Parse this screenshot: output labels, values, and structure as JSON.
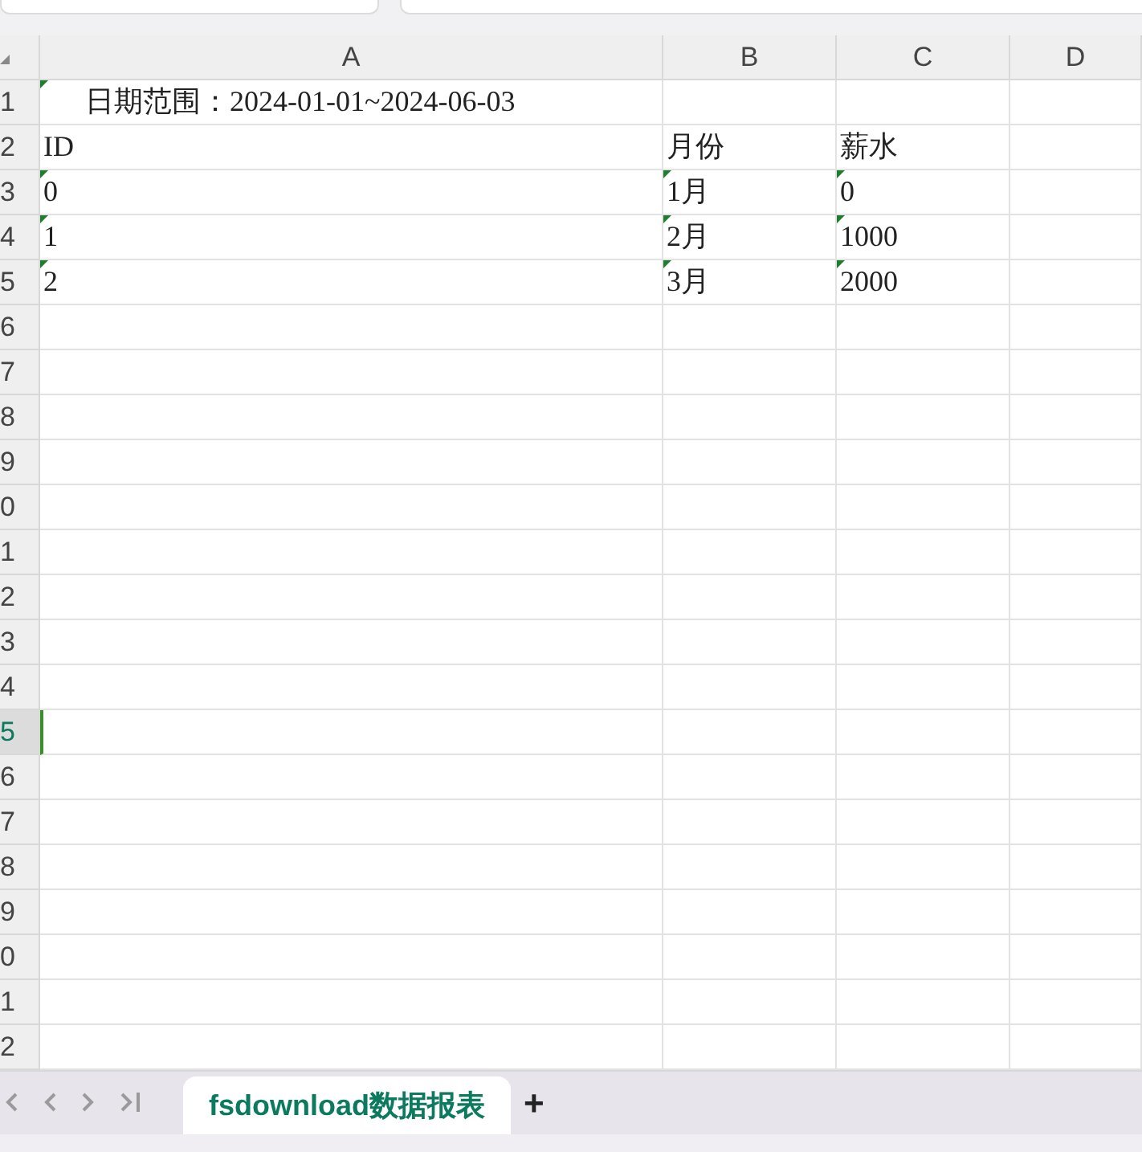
{
  "columns": [
    {
      "label": "A",
      "selected": false
    },
    {
      "label": "B",
      "selected": false
    },
    {
      "label": "C",
      "selected": false
    },
    {
      "label": "D",
      "selected": false
    }
  ],
  "rows": [
    {
      "header": "1",
      "selected": false,
      "cells": [
        {
          "text": "日期范围：2024-01-01~2024-06-03",
          "flag": true,
          "indent": true
        }
      ]
    },
    {
      "header": "2",
      "selected": false,
      "cells": [
        {
          "text": "ID",
          "flag": false
        },
        {
          "text": "月份",
          "flag": false
        },
        {
          "text": "薪水",
          "flag": false
        }
      ]
    },
    {
      "header": "3",
      "selected": false,
      "cells": [
        {
          "text": "0",
          "flag": true
        },
        {
          "text": "1月",
          "flag": true
        },
        {
          "text": "0",
          "flag": true
        }
      ]
    },
    {
      "header": "4",
      "selected": false,
      "cells": [
        {
          "text": "1",
          "flag": true
        },
        {
          "text": "2月",
          "flag": true
        },
        {
          "text": "1000",
          "flag": true
        }
      ]
    },
    {
      "header": "5",
      "selected": false,
      "cells": [
        {
          "text": "2",
          "flag": true
        },
        {
          "text": "3月",
          "flag": true
        },
        {
          "text": "2000",
          "flag": true
        }
      ]
    },
    {
      "header": "6",
      "selected": false
    },
    {
      "header": "7",
      "selected": false
    },
    {
      "header": "8",
      "selected": false
    },
    {
      "header": "9",
      "selected": false
    },
    {
      "header": "0",
      "selected": false
    },
    {
      "header": "1",
      "selected": false
    },
    {
      "header": "2",
      "selected": false
    },
    {
      "header": "3",
      "selected": false
    },
    {
      "header": "4",
      "selected": false
    },
    {
      "header": "5",
      "selected": true
    },
    {
      "header": "6",
      "selected": false
    },
    {
      "header": "7",
      "selected": false
    },
    {
      "header": "8",
      "selected": false
    },
    {
      "header": "9",
      "selected": false
    },
    {
      "header": "0",
      "selected": false
    },
    {
      "header": "1",
      "selected": false
    },
    {
      "header": "2",
      "selected": false
    }
  ],
  "sheet_tabs": [
    {
      "label": "fsdownload数据报表",
      "selected": true
    }
  ],
  "add_sheet": "+"
}
